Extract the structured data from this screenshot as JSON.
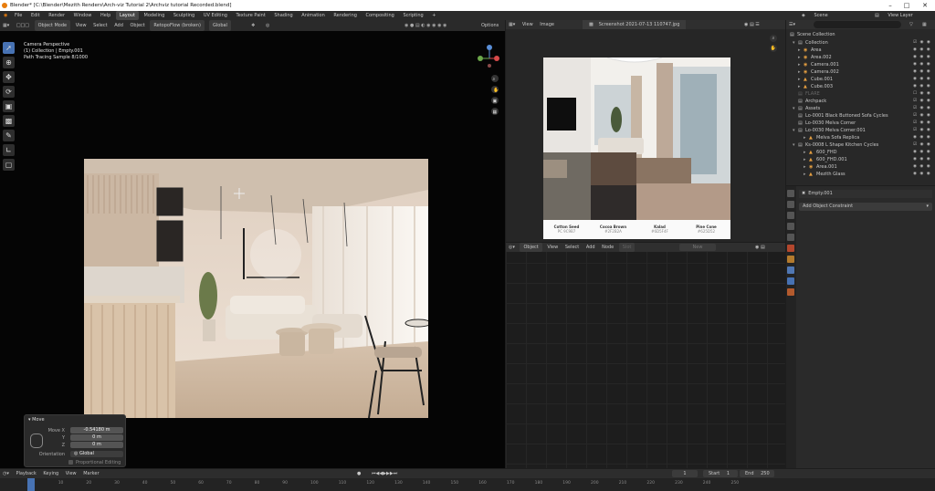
{
  "window": {
    "title": "Blender* [C:\\Blender\\Mezith Renders\\Arch-viz Tutorial 2\\Archviz tutorial Recorded.blend]"
  },
  "menu": {
    "items": [
      "File",
      "Edit",
      "Render",
      "Window",
      "Help"
    ],
    "workspaces": [
      "Layout",
      "Modeling",
      "Sculpting",
      "UV Editing",
      "Texture Paint",
      "Shading",
      "Animation",
      "Rendering",
      "Compositing",
      "Scripting"
    ],
    "active_workspace": "Layout",
    "scene": "Scene",
    "view_layer": "View Layer"
  },
  "viewport": {
    "header": {
      "mode": "Object Mode",
      "view": "View",
      "select": "Select",
      "add": "Add",
      "object": "Object",
      "extra": "RetopoFlow (broken)",
      "transform": "Global",
      "options": "Options"
    },
    "info": {
      "line1": "Camera Perspective",
      "line2": "(1) Collection | Empty.001",
      "line3": "Path Tracing Sample 8/1000"
    }
  },
  "move_panel": {
    "title": "Move",
    "move_x_label": "Move X",
    "move_x": "-0.54180 m",
    "y_label": "Y",
    "y": "0 m",
    "z_label": "Z",
    "z": "0 m",
    "orientation_label": "Orientation",
    "orientation": "Global",
    "proportional": "Proportional Editing"
  },
  "image_editor": {
    "view": "View",
    "image": "Image",
    "filename": "Screenshot 2021-07-13 110747.jpg",
    "swatches": [
      {
        "name": "Cotton Seed",
        "code": "PC 9C9B7"
      },
      {
        "name": "Cocoa Brown",
        "code": "#2F2B2A"
      },
      {
        "name": "Kalad",
        "code": "#6D5F4F"
      },
      {
        "name": "Pine Cone",
        "code": "#625D52"
      }
    ]
  },
  "node_editor": {
    "type": "Object",
    "view": "View",
    "select": "Select",
    "add": "Add",
    "node": "Node",
    "slot": "Slot",
    "new": "New"
  },
  "outliner": {
    "title": "Scene Collection",
    "items": [
      {
        "label": "Collection",
        "depth": 1
      },
      {
        "label": "Area",
        "depth": 2
      },
      {
        "label": "Area.002",
        "depth": 2
      },
      {
        "label": "Camera.001",
        "depth": 2
      },
      {
        "label": "Camera.002",
        "depth": 2
      },
      {
        "label": "Cube.001",
        "depth": 2
      },
      {
        "label": "Cube.003",
        "depth": 2
      },
      {
        "label": "FLARE",
        "depth": 1,
        "dim": true
      },
      {
        "label": "Archpack",
        "depth": 1
      },
      {
        "label": "Assets",
        "depth": 1
      },
      {
        "label": "Lo-0001 Black Buttoned Sofa Cycles",
        "depth": 2
      },
      {
        "label": "Lo-0030 Melva Corner",
        "depth": 2
      },
      {
        "label": "Lo-0030 Melva Corner.001",
        "depth": 2
      },
      {
        "label": "Melva Sofa Replica",
        "depth": 3
      },
      {
        "label": "Ks-0008 L Shape Kitchen Cycles",
        "depth": 2
      },
      {
        "label": "600_FHD",
        "depth": 3
      },
      {
        "label": "600_FHD.001",
        "depth": 3
      },
      {
        "label": "Area.001",
        "depth": 3
      },
      {
        "label": "Mezith Glass",
        "depth": 3
      }
    ]
  },
  "properties": {
    "object": "Empty.001",
    "add_constraint": "Add Object Constraint"
  },
  "timeline": {
    "playback": "Playback",
    "keying": "Keying",
    "view": "View",
    "marker": "Marker",
    "current_frame": "1",
    "start_label": "Start",
    "start": "1",
    "end_label": "End",
    "end": "250",
    "ticks": [
      "0",
      "10",
      "20",
      "30",
      "40",
      "50",
      "60",
      "70",
      "80",
      "90",
      "100",
      "110",
      "120",
      "130",
      "140",
      "150",
      "160",
      "170",
      "180",
      "190",
      "200",
      "210",
      "220",
      "230",
      "240",
      "250"
    ]
  },
  "colors": {
    "accent": "#4772b3",
    "active_object": "#e7a041",
    "header": "#2f2f2f",
    "background": "#1d1d1d"
  }
}
